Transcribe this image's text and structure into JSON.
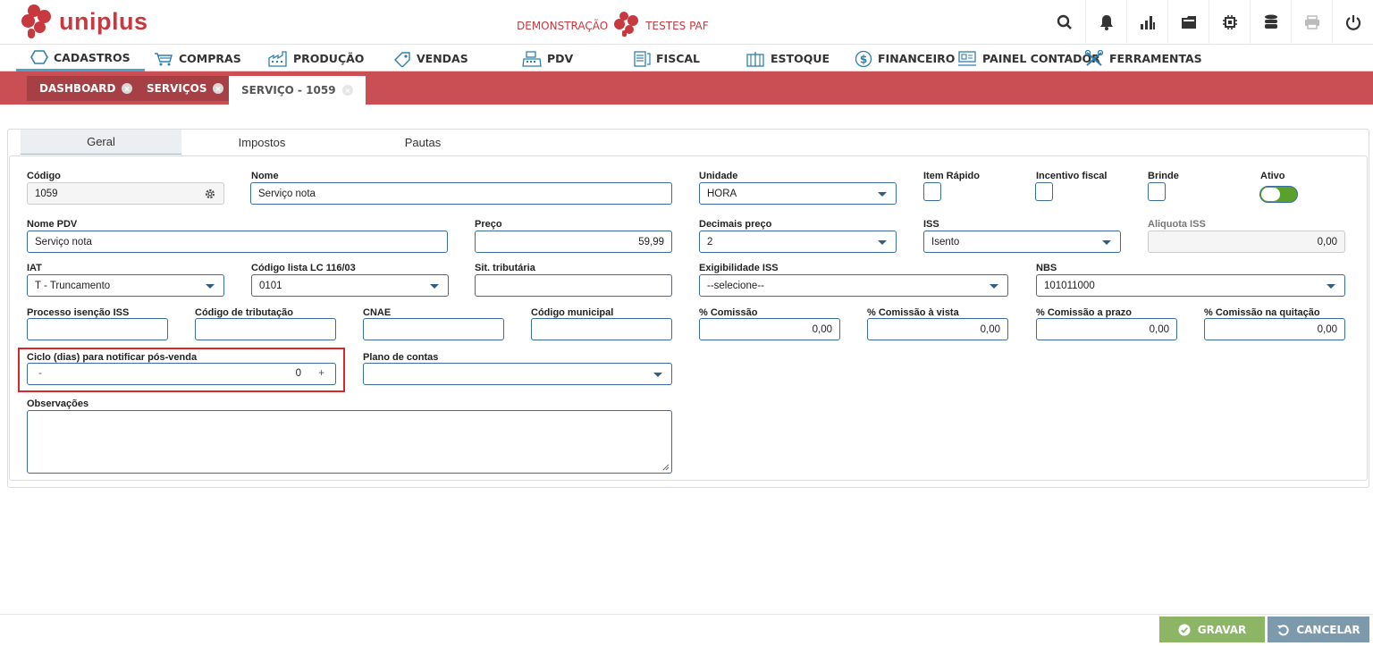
{
  "app": {
    "brand": "uniplus",
    "env_left": "DEMONSTRAÇÃO",
    "env_right": "TESTES PAF"
  },
  "top_icons": [
    "search-icon",
    "bell-icon",
    "bar-chart-icon",
    "folder-icon",
    "cpu-icon",
    "database-icon",
    "printer-icon",
    "power-icon"
  ],
  "menu": [
    {
      "label": "CADASTROS",
      "icon": "hexagon-icon"
    },
    {
      "label": "COMPRAS",
      "icon": "cart-icon"
    },
    {
      "label": "PRODUÇÃO",
      "icon": "factory-icon"
    },
    {
      "label": "VENDAS",
      "icon": "tag-icon"
    },
    {
      "label": "PDV",
      "icon": "register-icon"
    },
    {
      "label": "FISCAL",
      "icon": "document-icon"
    },
    {
      "label": "ESTOQUE",
      "icon": "box-icon"
    },
    {
      "label": "FINANCEIRO",
      "icon": "dollar-icon"
    },
    {
      "label": "PAINEL CONTADOR",
      "icon": "panel-icon"
    },
    {
      "label": "FERRAMENTAS",
      "icon": "tools-icon"
    }
  ],
  "doc_tabs": [
    {
      "label": "DASHBOARD"
    },
    {
      "label": "SERVIÇOS"
    },
    {
      "label": "SERVIÇO - 1059"
    }
  ],
  "subtabs": [
    "Geral",
    "Impostos",
    "Pautas"
  ],
  "form": {
    "codigo": {
      "label": "Código",
      "value": "1059"
    },
    "nome": {
      "label": "Nome",
      "value": "Serviço nota"
    },
    "unidade": {
      "label": "Unidade",
      "value": "HORA"
    },
    "item_rapido": {
      "label": "Item Rápido"
    },
    "incentivo": {
      "label": "Incentivo fiscal"
    },
    "brinde": {
      "label": "Brinde"
    },
    "ativo": {
      "label": "Ativo"
    },
    "nome_pdv": {
      "label": "Nome PDV",
      "value": "Serviço nota"
    },
    "preco": {
      "label": "Preço",
      "value": "59,99"
    },
    "decimais": {
      "label": "Decimais preço",
      "value": "2"
    },
    "iss": {
      "label": "ISS",
      "value": "Isento"
    },
    "aliquota_iss": {
      "label": "Aliquota ISS",
      "value": "0,00"
    },
    "iat": {
      "label": "IAT",
      "value": "T - Truncamento"
    },
    "codigo_lista": {
      "label": "Código lista LC 116/03",
      "value": "0101"
    },
    "sit_trib": {
      "label": "Sit. tributária",
      "value": ""
    },
    "exigibilidade": {
      "label": "Exigibilidade ISS",
      "value": "--selecione--"
    },
    "nbs": {
      "label": "NBS",
      "value": "101011000"
    },
    "processo": {
      "label": "Processo isenção ISS",
      "value": ""
    },
    "cod_trib": {
      "label": "Código de tributação",
      "value": ""
    },
    "cnae": {
      "label": "CNAE",
      "value": ""
    },
    "cod_mun": {
      "label": "Código municipal",
      "value": ""
    },
    "comissao": {
      "label": "% Comissão",
      "value": "0,00"
    },
    "comissao_vista": {
      "label": "% Comissão à vista",
      "value": "0,00"
    },
    "comissao_prazo": {
      "label": "% Comissão a prazo",
      "value": "0,00"
    },
    "comissao_quit": {
      "label": "% Comissão na quitação",
      "value": "0,00"
    },
    "ciclo": {
      "label": "Ciclo (dias) para notificar pós-venda",
      "value": "0",
      "minus": "-",
      "plus": "+"
    },
    "plano": {
      "label": "Plano de contas",
      "value": ""
    },
    "obs": {
      "label": "Observações",
      "value": ""
    }
  },
  "footer": {
    "save": "GRAVAR",
    "cancel": "CANCELAR"
  },
  "colors": {
    "brand": "#c8383f",
    "tabstrip": "#c94f54",
    "save": "#8cb565",
    "cancel": "#7d9aad",
    "highlight": "#d9252c",
    "toggle": "#5aa02c"
  }
}
